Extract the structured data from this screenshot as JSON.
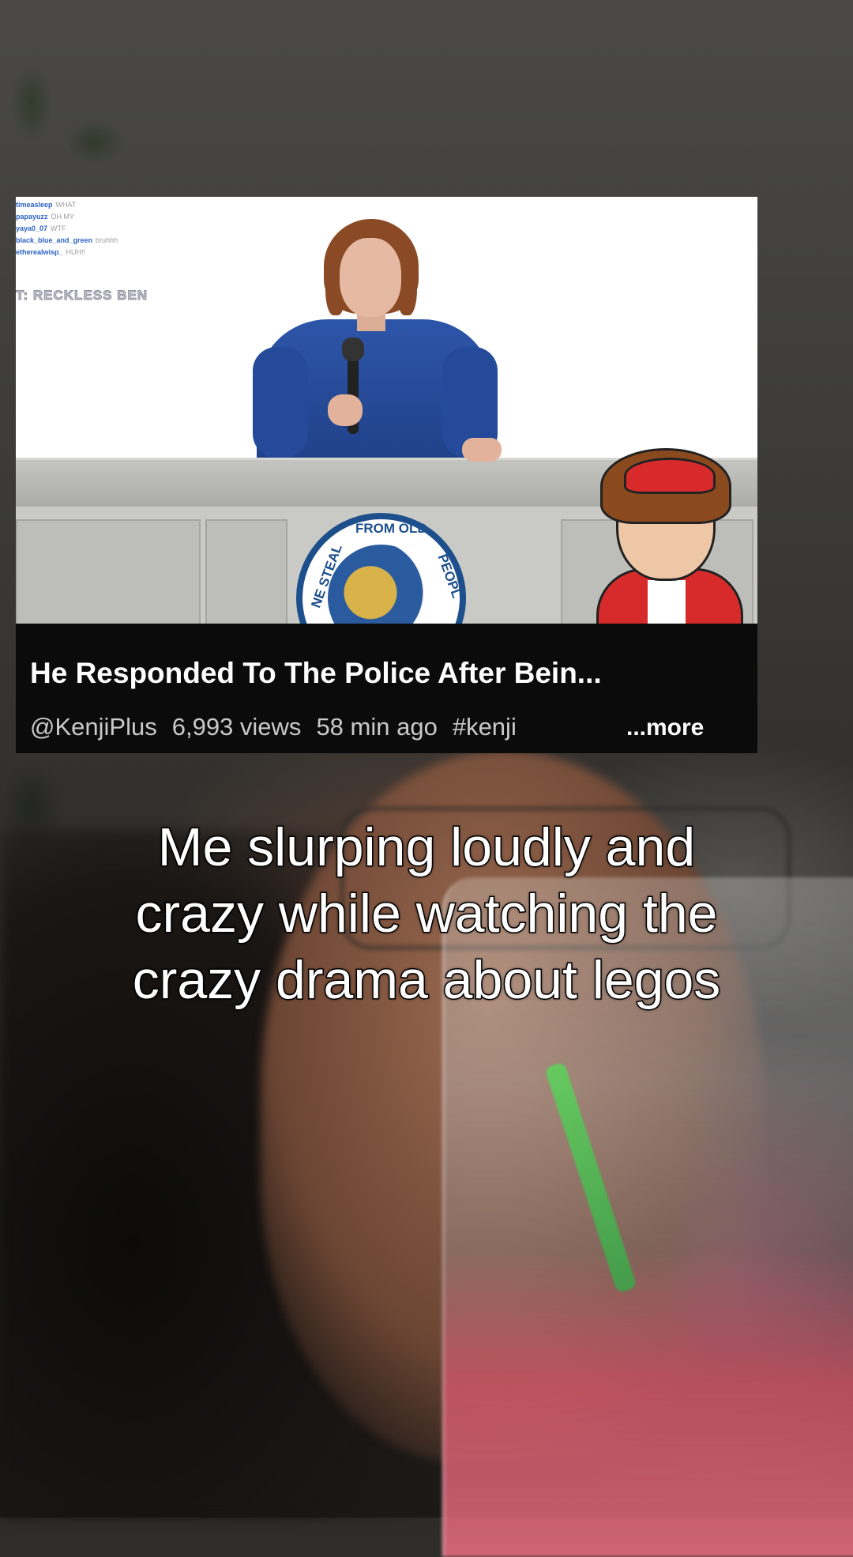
{
  "stream_overlay": {
    "chat": [
      {
        "user": "timeasleep",
        "message": "WHAT"
      },
      {
        "user": "papayuzz",
        "message": "OH MY"
      },
      {
        "user": "yaya0_07",
        "message": "WTF"
      },
      {
        "user": "black_blue_and_green",
        "message": "bruhhh"
      },
      {
        "user": "etherealwisp_",
        "message": "HUH!!"
      }
    ],
    "title": "T: RECKLESS BEN"
  },
  "seal": {
    "top_text": "FROM OLD",
    "left_text": "NE STEAL",
    "right_text": "PEOPL"
  },
  "video": {
    "title": "He Responded To The Police After Bein...",
    "channel": "@KenjiPlus",
    "views": "6,993 views",
    "time": "58 min ago",
    "hashtag": "#kenji",
    "more_label": "...more"
  },
  "caption": {
    "line1": "Me slurping loudly and",
    "line2": "crazy while watching the",
    "line3": "crazy drama about legos"
  }
}
